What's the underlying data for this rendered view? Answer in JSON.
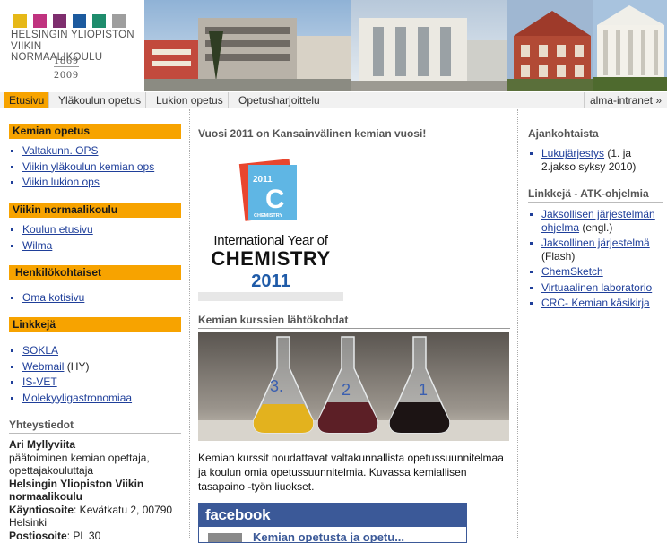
{
  "logo": {
    "line1": "HELSINGIN YLIOPISTON",
    "line2": "VIIKIN NORMAALIKOULU",
    "year_start": "1869",
    "year_end": "2009",
    "colors": [
      "#e6b817",
      "#c0337f",
      "#7e2e6e",
      "#1c5a9e",
      "#1e8c6c",
      "#9e9e9e"
    ]
  },
  "nav": {
    "tabs": [
      "Etusivu",
      "Yläkoulun opetus",
      "Lukion opetus",
      "Opetusharjoittelu"
    ],
    "active": "Etusivu",
    "right": "alma-intranet »"
  },
  "left": {
    "kemian_opetus": {
      "heading": "Kemian opetus",
      "links": [
        "Valtakunn. OPS",
        "Viikin yläkoulun kemian ops",
        "Viikin lukion ops"
      ]
    },
    "viikin_normaalikoulu": {
      "heading": "Viikin normaalikoulu",
      "links": [
        "Koulun etusivu",
        "Wilma"
      ]
    },
    "henkilokohtaiset": {
      "heading": "Henkilökohtaiset",
      "links": [
        "Oma kotisivu"
      ]
    },
    "linkkeja": {
      "heading": "Linkkejä",
      "links": [
        {
          "label": "SOKLA",
          "suffix": ""
        },
        {
          "label": "Webmail",
          "suffix": " (HY)"
        },
        {
          "label": "IS-VET",
          "suffix": ""
        },
        {
          "label": "Molekyyligastronomiaa",
          "suffix": ""
        }
      ]
    },
    "contact": {
      "heading": "Yhteystiedot",
      "name": "Ari Myllyviita",
      "title": "päätoiminen kemian opettaja, opettajakouluttaja",
      "org": "Helsingin Yliopiston Viikin normaalikoulu",
      "address_label": "Käyntiosoite",
      "address_value": ": Kevätkatu 2, 00790 Helsinki",
      "postal_label": "Postiosoite",
      "postal_value": ": PL 30"
    }
  },
  "center": {
    "heading1": "Vuosi 2011 on Kansainvälinen kemian vuosi!",
    "iyc": {
      "badge_year": "2011",
      "badge_letter": "C",
      "badge_word": "CHEMISTRY",
      "line1": "International Year of",
      "line2": "CHEMISTRY",
      "line3": "2011"
    },
    "heading2": "Kemian kurssien lähtökohdat",
    "description": "Kemian kurssit noudattavat valtakunnallista opetussuunnitelmaa ja koulun omia opetussuunnitelmia. Kuvassa kemiallisen tasapaino -työn liuokset.",
    "facebook": {
      "brand": "facebook",
      "name": "Kemian opetusta ja opetu..."
    }
  },
  "right": {
    "ajankohtaista": {
      "heading": "Ajankohtaista",
      "items": [
        {
          "label": "Lukujärjestys",
          "suffix": " (1. ja 2.jakso syksy 2010)"
        }
      ]
    },
    "atk": {
      "heading": "Linkkejä - ATK-ohjelmia",
      "items": [
        {
          "label": "Jaksollisen järjestelmän ohjelma",
          "suffix": " (engl.)"
        },
        {
          "label": "Jaksollinen järjestelmä",
          "suffix": " (Flash)"
        },
        {
          "label": "ChemSketch",
          "suffix": ""
        },
        {
          "label": "Virtuaalinen laboratorio",
          "suffix": ""
        },
        {
          "label": "CRC- Kemian käsikirja",
          "suffix": ""
        }
      ]
    }
  }
}
